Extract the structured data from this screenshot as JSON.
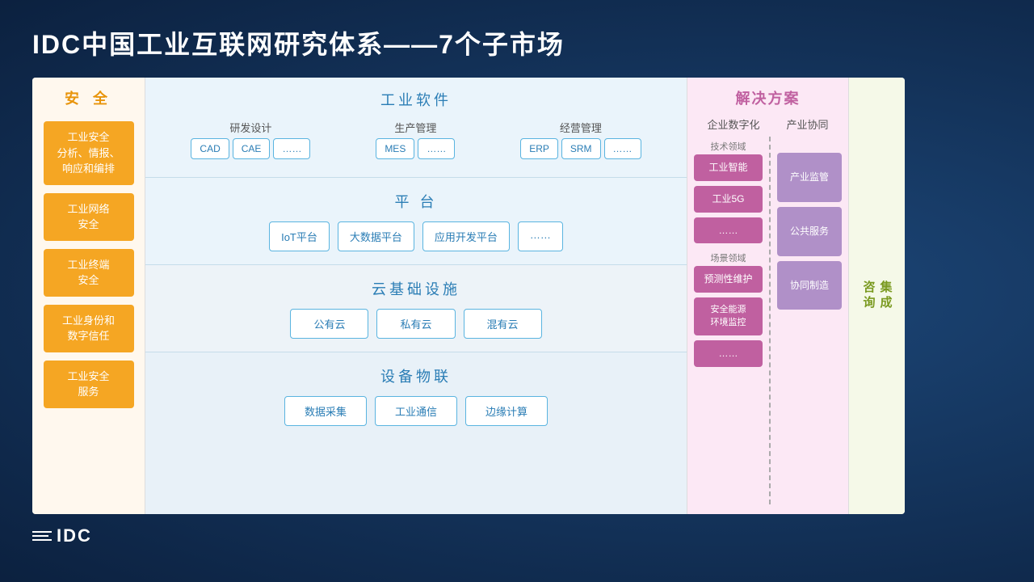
{
  "page": {
    "title": "IDC中国工业互联网研究体系——7个子市场",
    "background_color": "#1a3a5c"
  },
  "security": {
    "title": "安  全",
    "items": [
      {
        "label": "工业安全\n分析、情报、\n响应和编排"
      },
      {
        "label": "工业网络\n安全"
      },
      {
        "label": "工业终端\n安全"
      },
      {
        "label": "工业身份和\n数字信任"
      },
      {
        "label": "工业安全\n服务"
      }
    ]
  },
  "industrial_software": {
    "title": "工业软件",
    "subsections": [
      {
        "label": "研发设计",
        "tags": [
          "CAD",
          "CAE",
          "……"
        ]
      },
      {
        "label": "生产管理",
        "tags": [
          "MES",
          "……"
        ]
      },
      {
        "label": "经营管理",
        "tags": [
          "ERP",
          "SRM",
          "……"
        ]
      }
    ]
  },
  "platform": {
    "title": "平  台",
    "tags": [
      "IoT平台",
      "大数据平台",
      "应用开发平台",
      "……"
    ]
  },
  "cloud": {
    "title": "云基础设施",
    "tags": [
      "公有云",
      "私有云",
      "混有云"
    ]
  },
  "iot": {
    "title": "设备物联",
    "tags": [
      "数据采集",
      "工业通信",
      "边缘计算"
    ]
  },
  "solution": {
    "title": "解决方案",
    "col1_header": "企业数字化",
    "col2_header": "产业协同",
    "tech_label": "技术领域",
    "scene_label": "场景领域",
    "left_items": [
      {
        "label": "工业智能"
      },
      {
        "label": "工业5G"
      },
      {
        "label": "……"
      },
      {
        "label": "预测性维护"
      },
      {
        "label": "安全能源\n环境监控"
      },
      {
        "label": "……"
      }
    ],
    "right_items": [
      {
        "label": "产业监管",
        "span": 2
      },
      {
        "label": "公共服务"
      },
      {
        "label": "协同制造"
      }
    ]
  },
  "integration": {
    "label": "集成\n咨询"
  },
  "footer": {
    "logo_text": "IDC"
  }
}
